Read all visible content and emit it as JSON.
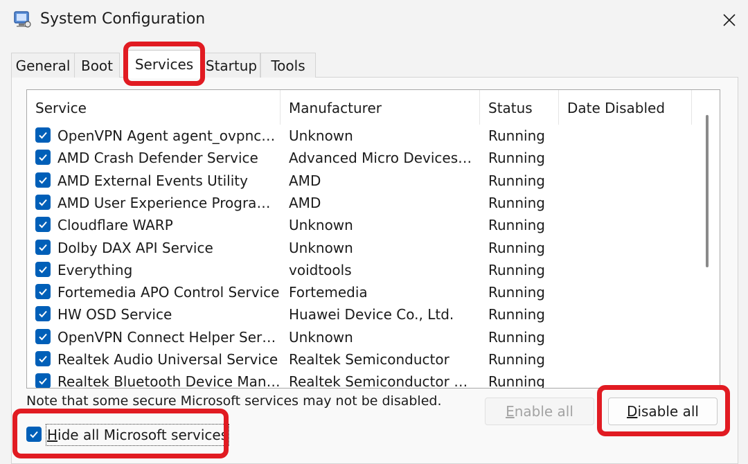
{
  "window": {
    "title": "System Configuration",
    "icon": "msconfig-icon",
    "close_icon": "close-icon"
  },
  "tabs": [
    {
      "label": "General",
      "active": false
    },
    {
      "label": "Boot",
      "active": false
    },
    {
      "label": "Services",
      "active": true
    },
    {
      "label": "Startup",
      "active": false
    },
    {
      "label": "Tools",
      "active": false
    }
  ],
  "services": {
    "columns": [
      "Service",
      "Manufacturer",
      "Status",
      "Date Disabled"
    ],
    "rows": [
      {
        "checked": true,
        "service": "OpenVPN Agent agent_ovpncon...",
        "manufacturer": "Unknown",
        "status": "Running",
        "date_disabled": ""
      },
      {
        "checked": true,
        "service": "AMD Crash Defender Service",
        "manufacturer": "Advanced Micro Devices, I...",
        "status": "Running",
        "date_disabled": ""
      },
      {
        "checked": true,
        "service": "AMD External Events Utility",
        "manufacturer": "AMD",
        "status": "Running",
        "date_disabled": ""
      },
      {
        "checked": true,
        "service": "AMD User Experience Program D...",
        "manufacturer": "AMD",
        "status": "Running",
        "date_disabled": ""
      },
      {
        "checked": true,
        "service": "Cloudflare WARP",
        "manufacturer": "Unknown",
        "status": "Running",
        "date_disabled": ""
      },
      {
        "checked": true,
        "service": "Dolby DAX API Service",
        "manufacturer": "Unknown",
        "status": "Running",
        "date_disabled": ""
      },
      {
        "checked": true,
        "service": "Everything",
        "manufacturer": "voidtools",
        "status": "Running",
        "date_disabled": ""
      },
      {
        "checked": true,
        "service": "Fortemedia APO Control Service",
        "manufacturer": "Fortemedia",
        "status": "Running",
        "date_disabled": ""
      },
      {
        "checked": true,
        "service": "HW OSD Service",
        "manufacturer": "Huawei Device Co., Ltd.",
        "status": "Running",
        "date_disabled": ""
      },
      {
        "checked": true,
        "service": "OpenVPN Connect Helper Service",
        "manufacturer": "Unknown",
        "status": "Running",
        "date_disabled": ""
      },
      {
        "checked": true,
        "service": "Realtek Audio Universal Service",
        "manufacturer": "Realtek Semiconductor",
        "status": "Running",
        "date_disabled": ""
      },
      {
        "checked": true,
        "service": "Realtek Bluetooth Device Manag...",
        "manufacturer": "Realtek Semiconductor Corp.",
        "status": "Running",
        "date_disabled": ""
      }
    ]
  },
  "note": "Note that some secure Microsoft services may not be disabled.",
  "buttons": {
    "enable_all": {
      "prefix": "",
      "accel": "E",
      "rest": "nable all",
      "enabled": false
    },
    "disable_all": {
      "prefix": "",
      "accel": "D",
      "rest": "isable all",
      "enabled": true
    }
  },
  "hide_microsoft": {
    "checked": true,
    "accel": "H",
    "rest": "ide all Microsoft services"
  },
  "colors": {
    "accent": "#005fb8",
    "highlight": "#e11b22"
  }
}
